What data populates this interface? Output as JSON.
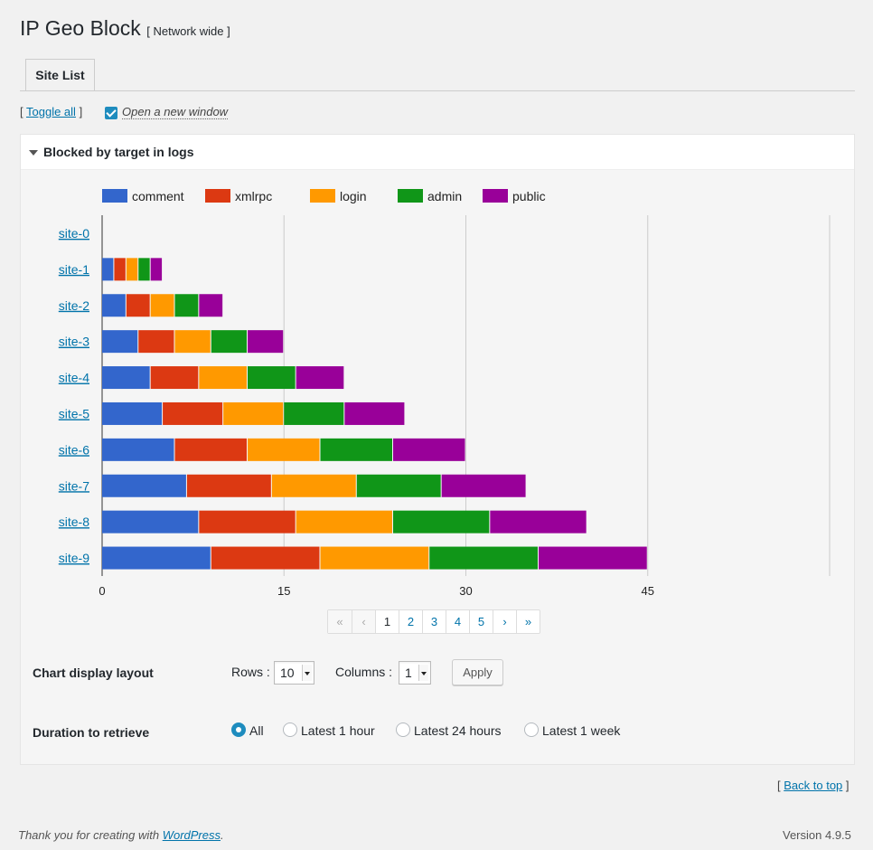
{
  "header": {
    "title": "IP Geo Block",
    "subtitle": "[ Network wide ]"
  },
  "tabs": [
    {
      "label": "Site List"
    }
  ],
  "toggle": {
    "prefix": "[",
    "link": "Toggle all",
    "suffix": "]",
    "checkbox_label": "Open a new window",
    "checked": true
  },
  "panel": {
    "title": "Blocked by target in logs"
  },
  "chart_data": {
    "type": "bar",
    "orientation": "horizontal",
    "stacked": true,
    "categories": [
      "site-0",
      "site-1",
      "site-2",
      "site-3",
      "site-4",
      "site-5",
      "site-6",
      "site-7",
      "site-8",
      "site-9"
    ],
    "series": [
      {
        "name": "comment",
        "color": "#3366cc",
        "values": [
          0,
          1,
          2,
          3,
          4,
          5,
          6,
          7,
          8,
          9
        ]
      },
      {
        "name": "xmlrpc",
        "color": "#dc3912",
        "values": [
          0,
          1,
          2,
          3,
          4,
          5,
          6,
          7,
          8,
          9
        ]
      },
      {
        "name": "login",
        "color": "#ff9900",
        "values": [
          0,
          1,
          2,
          3,
          4,
          5,
          6,
          7,
          8,
          9
        ]
      },
      {
        "name": "admin",
        "color": "#109618",
        "values": [
          0,
          1,
          2,
          3,
          4,
          5,
          6,
          7,
          8,
          9
        ]
      },
      {
        "name": "public",
        "color": "#990099",
        "values": [
          0,
          1,
          2,
          3,
          4,
          5,
          6,
          7,
          8,
          9
        ]
      }
    ],
    "xticks": [
      0,
      15,
      30,
      45
    ],
    "xlim": [
      0,
      60
    ],
    "grid": true,
    "legend": "top"
  },
  "pagination": {
    "items": [
      "«",
      "‹",
      "1",
      "2",
      "3",
      "4",
      "5",
      "›",
      "»"
    ],
    "current": "1"
  },
  "layout": {
    "label": "Chart display layout",
    "rows_label": "Rows :",
    "rows_value": "10",
    "columns_label": "Columns :",
    "columns_value": "1",
    "apply": "Apply"
  },
  "duration": {
    "label": "Duration to retrieve",
    "options": [
      "All",
      "Latest 1 hour",
      "Latest 24 hours",
      "Latest 1 week"
    ],
    "selected": "All"
  },
  "back_to_top": {
    "prefix": "[",
    "link": "Back to top",
    "suffix": "]"
  },
  "footer": {
    "text": "Thank you for creating with ",
    "link": "WordPress",
    "end": ".",
    "version": "Version 4.9.5"
  }
}
